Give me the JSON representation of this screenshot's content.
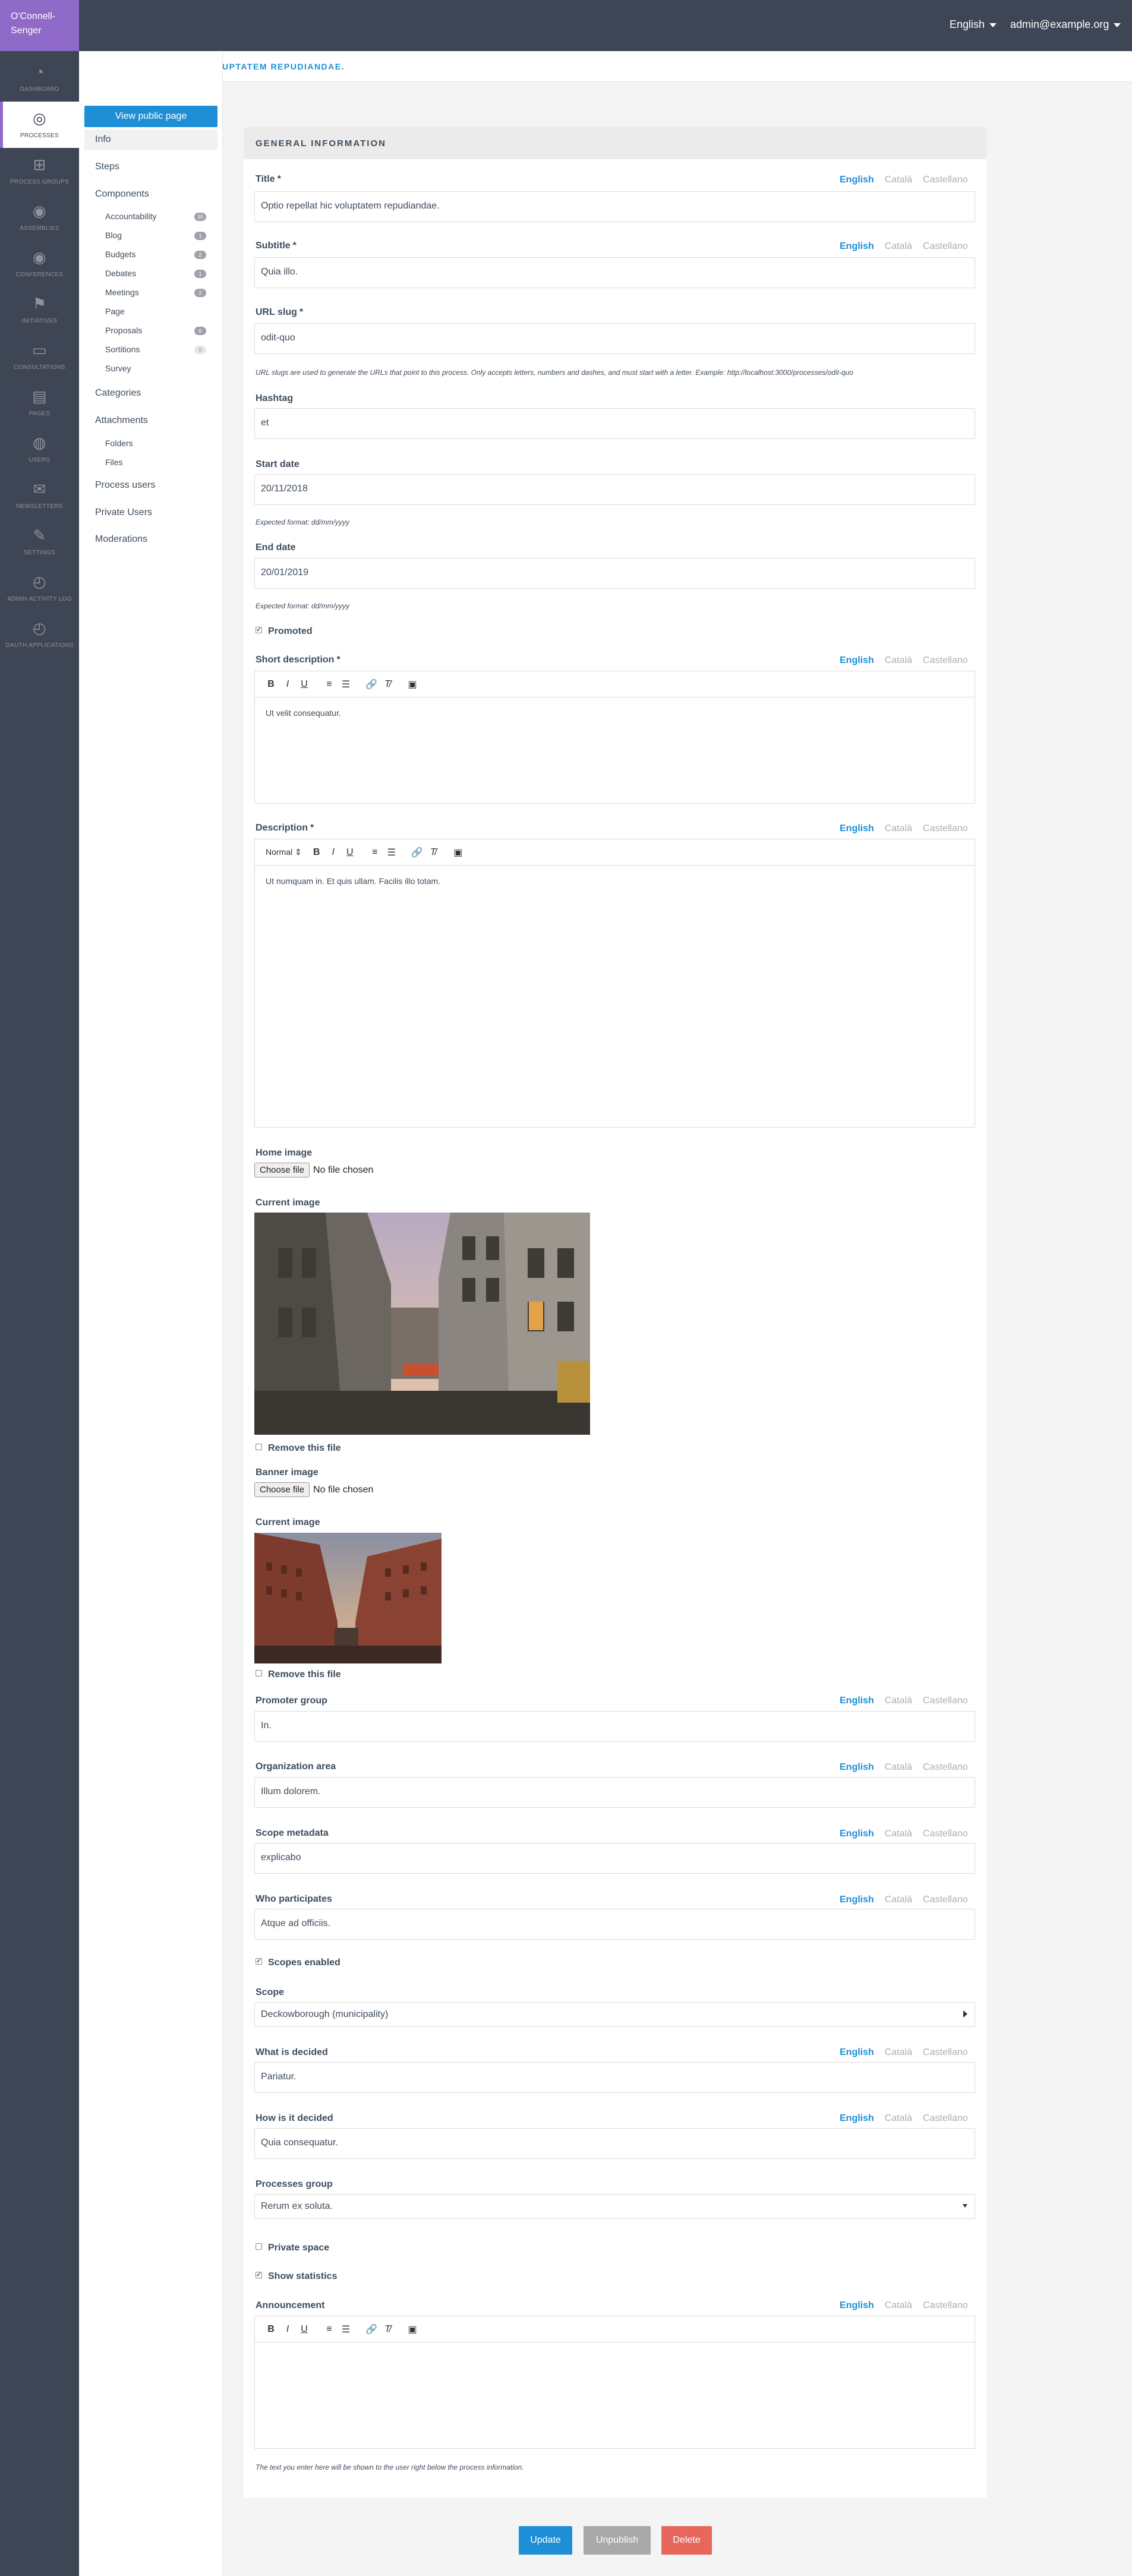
{
  "org_name": "O'Connell-Senger",
  "topbar": {
    "language": "English",
    "user": "admin@example.org"
  },
  "main_sidebar": [
    {
      "label": "DASHBOARD",
      "icon": "dashboard-icon"
    },
    {
      "label": "PROCESSES",
      "icon": "processes-icon",
      "active": true
    },
    {
      "label": "PROCESS GROUPS",
      "icon": "process-groups-icon"
    },
    {
      "label": "ASSEMBLIES",
      "icon": "assemblies-icon"
    },
    {
      "label": "CONFERENCES",
      "icon": "conferences-icon"
    },
    {
      "label": "INITIATIVES",
      "icon": "initiatives-icon"
    },
    {
      "label": "CONSULTATIONS",
      "icon": "consultations-icon"
    },
    {
      "label": "PAGES",
      "icon": "pages-icon"
    },
    {
      "label": "USERS",
      "icon": "users-icon"
    },
    {
      "label": "NEWSLETTERS",
      "icon": "newsletters-icon"
    },
    {
      "label": "SETTINGS",
      "icon": "settings-icon"
    },
    {
      "label": "ADMIN ACTIVITY LOG",
      "icon": "admin-log-icon"
    },
    {
      "label": "OAUTH APPLICATIONS",
      "icon": "oauth-icon"
    }
  ],
  "process_title": "OPTIO REPELLAT HIC VOLUPTATEM REPUDIANDAE.",
  "secondary_sidebar": {
    "view_public": "View public page",
    "info": "Info",
    "steps": "Steps",
    "components": "Components",
    "component_items": [
      {
        "label": "Accountability",
        "badge": "30"
      },
      {
        "label": "Blog",
        "badge": "1"
      },
      {
        "label": "Budgets",
        "badge": "2"
      },
      {
        "label": "Debates",
        "badge": "1"
      },
      {
        "label": "Meetings",
        "badge": "2"
      },
      {
        "label": "Page",
        "badge": ""
      },
      {
        "label": "Proposals",
        "badge": "6"
      },
      {
        "label": "Sortitions",
        "badge": "0"
      },
      {
        "label": "Survey",
        "badge": ""
      }
    ],
    "categories": "Categories",
    "attachments": "Attachments",
    "folders": "Folders",
    "files": "Files",
    "process_users": "Process users",
    "private_users": "Private Users",
    "moderations": "Moderations"
  },
  "form": {
    "section_title": "GENERAL INFORMATION",
    "langs": [
      "English",
      "Català",
      "Castellano"
    ],
    "title_label": "Title",
    "title_value": "Optio repellat hic voluptatem repudiandae.",
    "subtitle_label": "Subtitle",
    "subtitle_value": "Quia illo.",
    "slug_label": "URL slug",
    "slug_value": "odit-quo",
    "slug_help": "URL slugs are used to generate the URLs that point to this process. Only accepts letters, numbers and dashes, and must start with a letter. Example: http://localhost:3000/processes/odit-quo",
    "hashtag_label": "Hashtag",
    "hashtag_value": "et",
    "start_label": "Start date",
    "start_value": "20/11/2018",
    "date_help": "Expected format: dd/mm/yyyy",
    "end_label": "End date",
    "end_value": "20/01/2019",
    "promoted_label": "Promoted",
    "short_desc_label": "Short description",
    "short_desc_value": "Ut velit consequatur.",
    "desc_label": "Description",
    "desc_heading_select": "Normal",
    "desc_value": "Ut numquam in.  Et quis ullam.  Facilis illo totam.",
    "home_image_label": "Home image",
    "choose_file": "Choose file",
    "no_file": "No file chosen",
    "current_image_label": "Current image",
    "remove_file": "Remove this file",
    "banner_image_label": "Banner image",
    "promoter_label": "Promoter group",
    "promoter_value": "In.",
    "org_area_label": "Organization area",
    "org_area_value": "Illum dolorem.",
    "scope_meta_label": "Scope metadata",
    "scope_meta_value": "explicabo",
    "who_label": "Who participates",
    "who_value": "Atque ad officiis.",
    "scopes_enabled_label": "Scopes enabled",
    "scope_label": "Scope",
    "scope_value": "Deckowborough (municipality)",
    "what_label": "What is decided",
    "what_value": "Pariatur.",
    "how_label": "How is it decided",
    "how_value": "Quia consequatur.",
    "group_label": "Processes group",
    "group_value": "Rerum ex soluta.",
    "private_label": "Private space",
    "stats_label": "Show statistics",
    "announcement_label": "Announcement",
    "announcement_help": "The text you enter here will be shown to the user right below the process information."
  },
  "actions": {
    "update": "Update",
    "unpublish": "Unpublish",
    "delete": "Delete"
  },
  "colors": {
    "accent": "#1e8fd6",
    "brand": "#8f6ac8",
    "sidebar": "#3e4554",
    "delete": "#e7675c",
    "disabled": "#a9a9a9"
  }
}
